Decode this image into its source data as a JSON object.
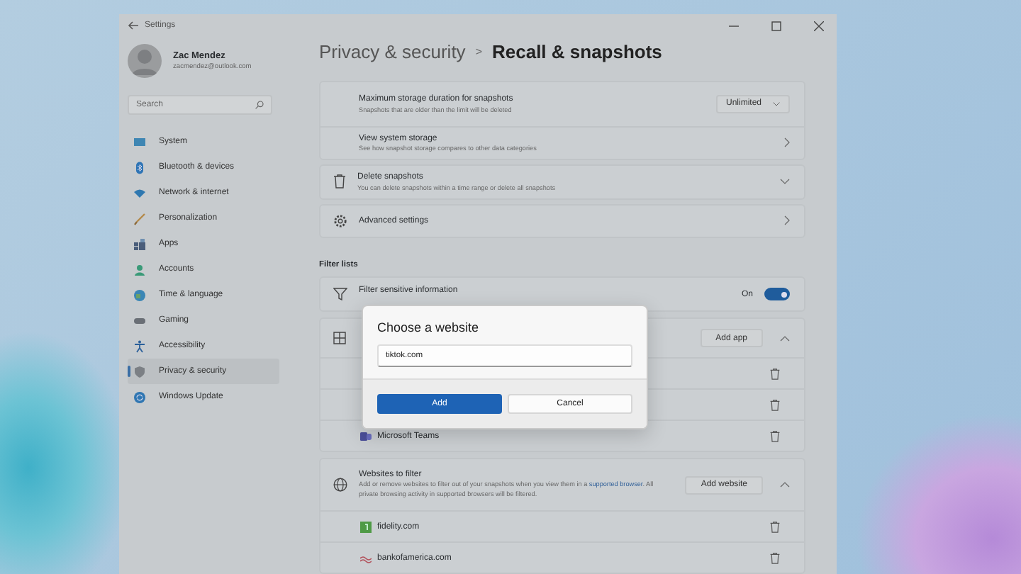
{
  "window": {
    "title": "Settings"
  },
  "user": {
    "name": "Zac Mendez",
    "email": "zacmendez@outlook.com"
  },
  "search": {
    "placeholder": "Search"
  },
  "nav": [
    {
      "label": "System",
      "selected": false
    },
    {
      "label": "Bluetooth & devices",
      "selected": false
    },
    {
      "label": "Network & internet",
      "selected": false
    },
    {
      "label": "Personalization",
      "selected": false
    },
    {
      "label": "Apps",
      "selected": false
    },
    {
      "label": "Accounts",
      "selected": false
    },
    {
      "label": "Time & language",
      "selected": false
    },
    {
      "label": "Gaming",
      "selected": false
    },
    {
      "label": "Accessibility",
      "selected": false
    },
    {
      "label": "Privacy & security",
      "selected": true
    },
    {
      "label": "Windows Update",
      "selected": false
    }
  ],
  "breadcrumb": {
    "parent": "Privacy & security",
    "separator": ">",
    "current": "Recall & snapshots"
  },
  "storage_rows": [
    {
      "kind": "dropdown",
      "title": "Maximum storage duration for snapshots",
      "description": "Snapshots that are older than the limit will be deleted",
      "value": "Unlimited"
    },
    {
      "kind": "link",
      "title": "View system storage",
      "description": "See how snapshot storage compares to other data categories"
    }
  ],
  "delete_snapshots": {
    "title": "Delete snapshots",
    "description": "You can delete snapshots within a time range or delete all snapshots",
    "expanded": false
  },
  "advanced_settings": {
    "title": "Advanced settings"
  },
  "filter_lists": {
    "heading": "Filter lists",
    "sensitive": {
      "title": "Filter sensitive information",
      "toggle_label": "On",
      "on": true
    },
    "apps": {
      "button": "Add app",
      "expanded": true,
      "items": [
        {
          "kind": "hidden"
        },
        {
          "kind": "hidden"
        },
        {
          "kind": "app",
          "name": "Microsoft Teams"
        }
      ]
    },
    "websites": {
      "title": "Websites to filter",
      "description_before": "Add or remove websites to filter out of your snapshots when you view them in a",
      "link": "supported browser",
      "description_after": ". All private browsing activity in supported browsers will be filtered.",
      "button": "Add website",
      "expanded": true,
      "items": [
        "fidelity.com",
        "bankofamerica.com"
      ]
    }
  },
  "dialog": {
    "title": "Choose a website",
    "value": "tiktok.com",
    "primary": "Add",
    "secondary": "Cancel"
  }
}
